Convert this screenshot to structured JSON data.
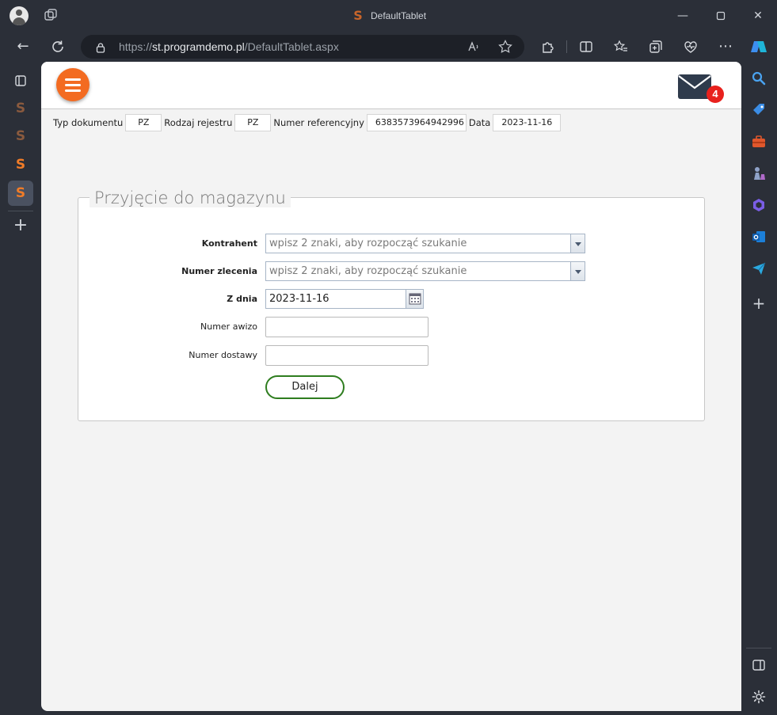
{
  "browser": {
    "tab_title": "DefaultTablet",
    "url_scheme": "https://",
    "url_host": "st.programdemo.pl",
    "url_path": "/DefaultTablet.aspx",
    "tab_logo_letter": "S"
  },
  "header": {
    "mail_badge_count": "4"
  },
  "infobar": {
    "doc_type_label": "Typ dokumentu",
    "doc_type_value": "PZ",
    "register_type_label": "Rodzaj rejestru",
    "register_type_value": "PZ",
    "ref_number_label": "Numer referencyjny",
    "ref_number_value": "6383573964942996",
    "date_label": "Data",
    "date_value": "2023-11-16"
  },
  "form": {
    "title": "Przyjęcie do magazynu",
    "contractor_label": "Kontrahent",
    "contractor_placeholder": "wpisz 2 znaki, aby rozpocząć szukanie",
    "order_number_label": "Numer zlecenia",
    "order_number_placeholder": "wpisz 2 znaki, aby rozpocząć szukanie",
    "from_date_label": "Z dnia",
    "from_date_value": "2023-11-16",
    "advice_number_label": "Numer awizo",
    "advice_number_value": "",
    "delivery_number_label": "Numer dostawy",
    "delivery_number_value": "",
    "next_button": "Dalej"
  },
  "colors": {
    "accent_orange": "#f36b21",
    "badge_red": "#e8211d",
    "button_border_green": "#2e7d1f"
  }
}
